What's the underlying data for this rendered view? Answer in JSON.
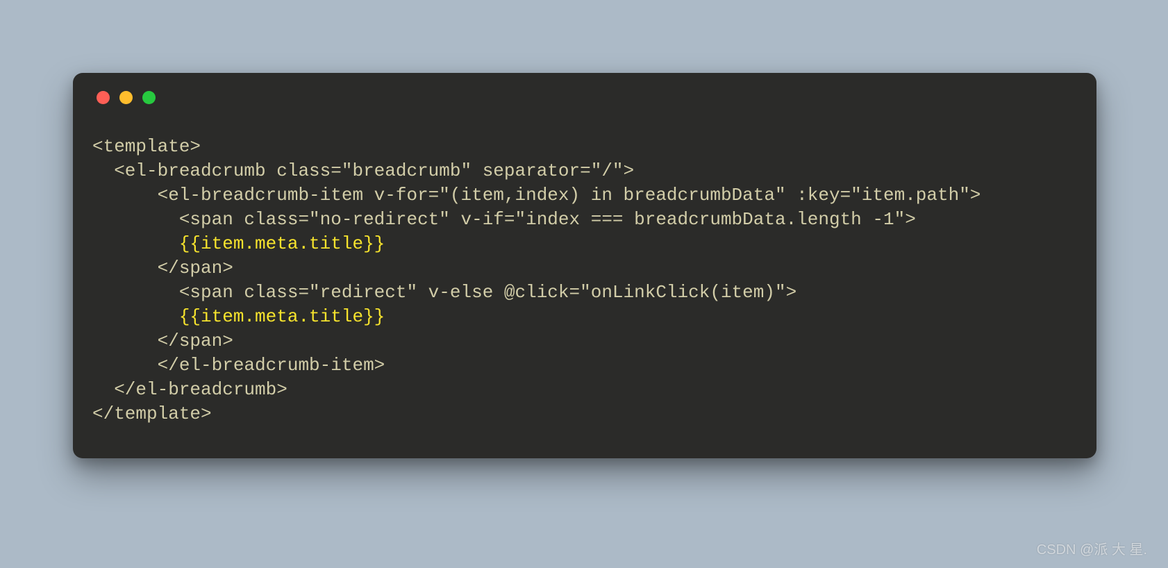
{
  "colors": {
    "page_bg": "#acbac7",
    "window_bg": "#2b2b29",
    "code_fg": "#d2cda8",
    "highlight_fg": "#f6e32d",
    "dot_red": "#ff5f56",
    "dot_yellow": "#ffbd2d",
    "dot_green": "#27c93f"
  },
  "code": {
    "l1": "<template>",
    "l2": "  <el-breadcrumb class=\"breadcrumb\" separator=\"/\">",
    "l3": "      <el-breadcrumb-item v-for=\"(item,index) in breadcrumbData\" :key=\"item.path\">",
    "l4a": "        <span class=\"no-redirect\" v-if=\"index === breadcrumbData.length -1\">",
    "l5": "        {{item.meta.title}}",
    "l6": "      </span>",
    "l7": "        <span class=\"redirect\" v-else @click=\"onLinkClick(item)\">",
    "l8": "        {{item.meta.title}}",
    "l9": "      </span>",
    "l10": "      </el-breadcrumb-item>",
    "l11": "  </el-breadcrumb>",
    "l12": "</template>"
  },
  "watermark": "CSDN @派 大 星."
}
